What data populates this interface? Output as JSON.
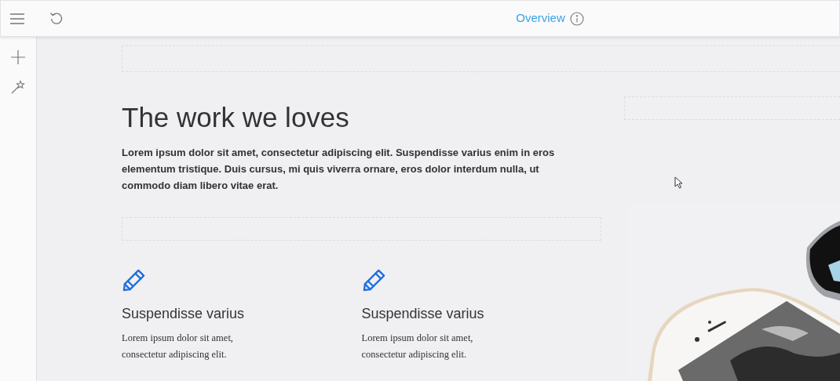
{
  "toolbar": {
    "title": "Overview"
  },
  "section": {
    "heading": "The work we loves",
    "intro": "Lorem ipsum dolor sit amet, consectetur adipiscing elit. Suspendisse varius enim in eros elementum tristique. Duis cursus, mi quis viverra ornare, eros dolor interdum nulla, ut commodo diam libero vitae erat."
  },
  "features": [
    {
      "title": "Suspendisse varius",
      "text": "Lorem ipsum dolor sit amet, consectetur adipiscing elit."
    },
    {
      "title": "Suspendisse varius",
      "text": "Lorem ipsum dolor sit amet, consectetur adipiscing elit."
    }
  ]
}
